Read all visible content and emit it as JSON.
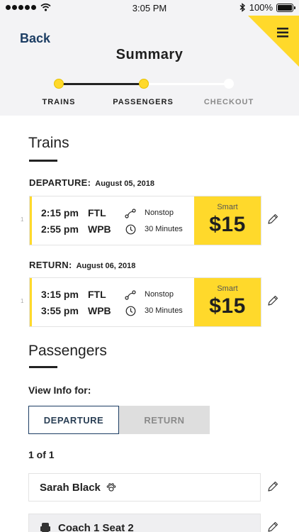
{
  "status_bar": {
    "time": "3:05 PM",
    "battery_label": "100%",
    "battery_level": 1.0,
    "icons": [
      "signal-dots-icon",
      "wifi-icon",
      "bluetooth-icon",
      "battery-icon"
    ]
  },
  "header": {
    "back_label": "Back",
    "title": "Summary",
    "menu_icon": "hamburger-menu-icon",
    "accent_color": "#ffd92b"
  },
  "progress": {
    "steps": [
      {
        "label": "TRAINS",
        "state": "done"
      },
      {
        "label": "PASSENGERS",
        "state": "current"
      },
      {
        "label": "CHECKOUT",
        "state": "todo"
      }
    ]
  },
  "trains": {
    "title": "Trains",
    "departure": {
      "label": "DEPARTURE:",
      "date": "August 05, 2018",
      "row_num": "1",
      "depart_time": "2:15 pm",
      "depart_station": "FTL",
      "arrive_time": "2:55 pm",
      "arrive_station": "WPB",
      "stops": "Nonstop",
      "duration": "30 Minutes",
      "fare_class": "Smart",
      "price": "$15"
    },
    "return": {
      "label": "RETURN:",
      "date": "August 06, 2018",
      "row_num": "1",
      "depart_time": "3:15 pm",
      "depart_station": "FTL",
      "arrive_time": "3:55 pm",
      "arrive_station": "WPB",
      "stops": "Nonstop",
      "duration": "30 Minutes",
      "fare_class": "Smart",
      "price": "$15"
    }
  },
  "passengers": {
    "title": "Passengers",
    "view_info_label": "View Info for:",
    "toggle": {
      "departure": "DEPARTURE",
      "return": "RETURN",
      "selected": "DEPARTURE"
    },
    "count": "1 of 1",
    "name": "Sarah Black",
    "name_icon": "paw-icon",
    "seat": "Coach 1 Seat 2",
    "seat_icon": "seat-icon"
  }
}
